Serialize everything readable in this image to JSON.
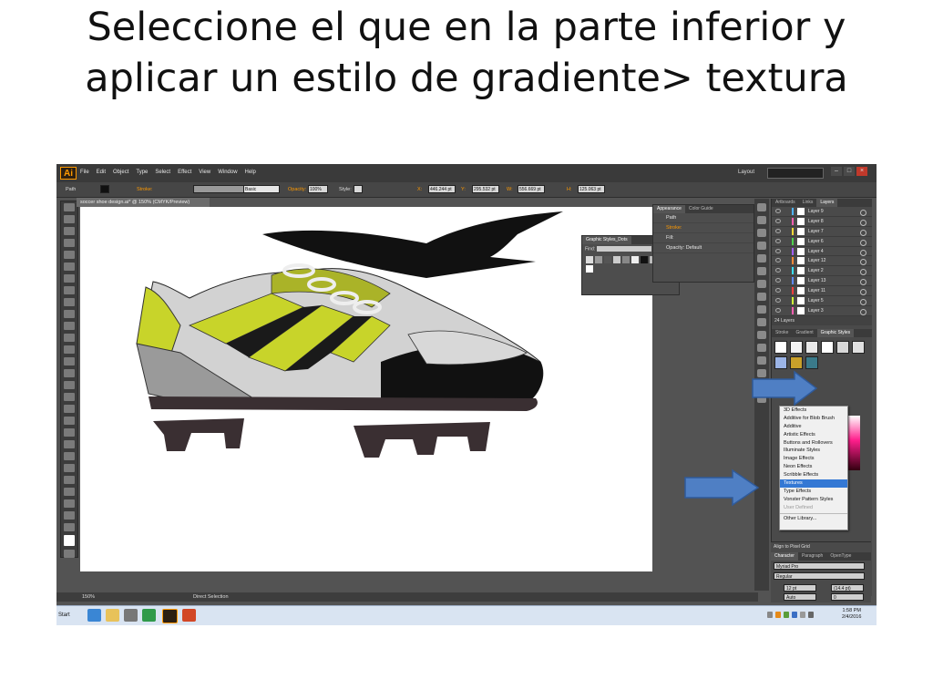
{
  "slide": {
    "title_line1": "Seleccione el que en la parte inferior y",
    "title_line2": "aplicar un estilo de gradiente> textura"
  },
  "app": {
    "logo": "Ai",
    "menu": [
      "File",
      "Edit",
      "Object",
      "Type",
      "Select",
      "Effect",
      "View",
      "Window",
      "Help"
    ],
    "workspace_label": "Layout",
    "window_controls": [
      "–",
      "□",
      "×"
    ]
  },
  "control_bar": {
    "path_label": "Path",
    "stroke_label": "Stroke:",
    "basic_label": "Basic",
    "opacity_label": "Opacity:",
    "opacity_value": "100%",
    "style_label": "Style:",
    "x_label": "X:",
    "x_value": "446.244 pt",
    "y_label": "Y:",
    "y_value": "295.532 pt",
    "w_label": "W:",
    "w_value": "556.669 pt",
    "h_label": "H:",
    "h_value": "125.063 pt"
  },
  "document": {
    "tab": "soccer shoe design.ai* @ 150% (CMYK/Preview)"
  },
  "status_bar": {
    "zoom": "150%",
    "tool": "Direct Selection"
  },
  "graphic_styles_library": {
    "title": "Graphic Styles_Dots",
    "find_label": "Find:"
  },
  "appearance_panel": {
    "tabs": [
      "Appearance",
      "Color Guide"
    ],
    "rows": [
      "Path",
      "Stroke:",
      "Fill:",
      "Opacity: Default"
    ]
  },
  "layers_panel": {
    "tabs": [
      "Artboards",
      "Links",
      "Layers"
    ],
    "layers": [
      "Layer 9",
      "Layer 8",
      "Layer 7",
      "Layer 6",
      "Layer 4",
      "Layer 12",
      "Layer 2",
      "Layer 13",
      "Layer 11",
      "Layer 5",
      "Layer 3"
    ],
    "footer": "24 Layers"
  },
  "styles_panel": {
    "tabs": [
      "Stroke",
      "Gradient",
      "Graphic Styles"
    ]
  },
  "style_library_menu": {
    "items": [
      "3D Effects",
      "Additive for Blob Brush",
      "Additive",
      "Artistic Effects",
      "Buttons and Rollovers",
      "Illuminate Styles",
      "Image Effects",
      "Neon Effects",
      "Scribble Effects",
      "Textures",
      "Type Effects",
      "Vonster Pattern Styles",
      "User Defined",
      "Other Library..."
    ],
    "selected": "Textures"
  },
  "character_panel": {
    "tabs": [
      "Character",
      "Paragraph",
      "OpenType"
    ],
    "align_label": "Align to Pixel Grid",
    "font": "Myriad Pro",
    "style": "Regular",
    "size": "12 pt",
    "leading": "(14.4 pt)",
    "kerning": "Auto",
    "tracking": "0"
  },
  "taskbar": {
    "start": "Start",
    "time": "1:58 PM",
    "date": "2/4/2016"
  },
  "colors": {
    "lime": "#c8d42a",
    "arrow_blue": "#4f7fc4",
    "menu_highlight": "#3478d4",
    "ai_orange": "#ff9a00"
  }
}
